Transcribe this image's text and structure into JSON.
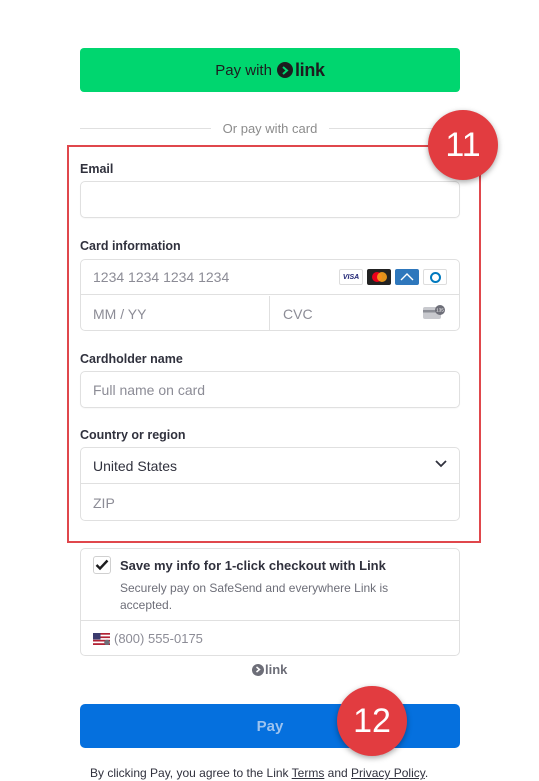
{
  "link_button": {
    "prefix": "Pay with",
    "brand": "link"
  },
  "divider": {
    "text": "Or pay with card"
  },
  "annotations": {
    "badge_1": "11",
    "badge_2": "12"
  },
  "email": {
    "label": "Email",
    "value": "",
    "placeholder": ""
  },
  "card": {
    "label": "Card information",
    "number_placeholder": "1234 1234 1234 1234",
    "expiry_placeholder": "MM / YY",
    "cvc_placeholder": "CVC",
    "brands": [
      "visa-icon",
      "mastercard-icon",
      "amex-icon",
      "diners-icon"
    ],
    "visa_text": "VISA",
    "amex_text": "AMEX",
    "cvc_icon_text": "135"
  },
  "cardholder": {
    "label": "Cardholder name",
    "placeholder": "Full name on card"
  },
  "country": {
    "label": "Country or region",
    "value": "United States",
    "zip_placeholder": "ZIP"
  },
  "save": {
    "checked": true,
    "title": "Save my info for 1-click checkout with Link",
    "description": "Securely pay on SafeSend and everywhere Link is accepted.",
    "phone_placeholder": "(800) 555-0175"
  },
  "link_footer": {
    "brand": "link"
  },
  "pay_button": {
    "label": "Pay"
  },
  "legal": {
    "prefix": "By clicking Pay, you agree to the Link ",
    "terms": "Terms",
    "and": " and ",
    "privacy": "Privacy Policy",
    "suffix": "."
  },
  "colors": {
    "link_green": "#00d66f",
    "pay_blue": "#0570de",
    "annotation_red": "#e23c40"
  }
}
